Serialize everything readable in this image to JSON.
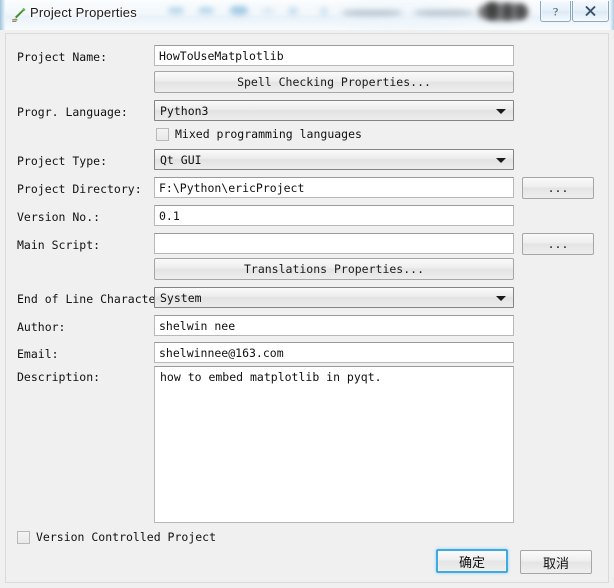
{
  "window": {
    "title": "Project Properties",
    "icon": "pen-icon",
    "help_button": "?",
    "close_button": "✕"
  },
  "form": {
    "project_name": {
      "label": "Project Name:",
      "value": "HowToUseMatplotlib",
      "placeholder": ""
    },
    "spell_checking_button": "Spell Checking Properties...",
    "programming_language": {
      "label": "Progr. Language:",
      "value": "Python3"
    },
    "mixed_languages": {
      "label": "Mixed programming languages",
      "checked": false
    },
    "project_type": {
      "label": "Project Type:",
      "value": "Qt GUI"
    },
    "project_directory": {
      "label": "Project Directory:",
      "value": "F:\\Python\\ericProject",
      "browse_button": "..."
    },
    "version_no": {
      "label": "Version No.:",
      "value": "0.1"
    },
    "main_script": {
      "label": "Main Script:",
      "value": "",
      "browse_button": "..."
    },
    "translations_button": "Translations Properties...",
    "eol_character": {
      "label": "End of Line Character:",
      "value": "System"
    },
    "author": {
      "label": "Author:",
      "value": "shelwin nee"
    },
    "email": {
      "label": "Email:",
      "value": "shelwinnee@163.com"
    },
    "description": {
      "label": "Description:",
      "value": "how to embed matplotlib in pyqt."
    },
    "version_controlled": {
      "label": "Version Controlled Project",
      "checked": false
    }
  },
  "buttons": {
    "ok": "确定",
    "cancel": "取消"
  },
  "colors": {
    "accent": "#3fa9e0",
    "dialog_bg": "#f0f0f0",
    "field_bg": "#ffffff",
    "text": "#111111"
  }
}
